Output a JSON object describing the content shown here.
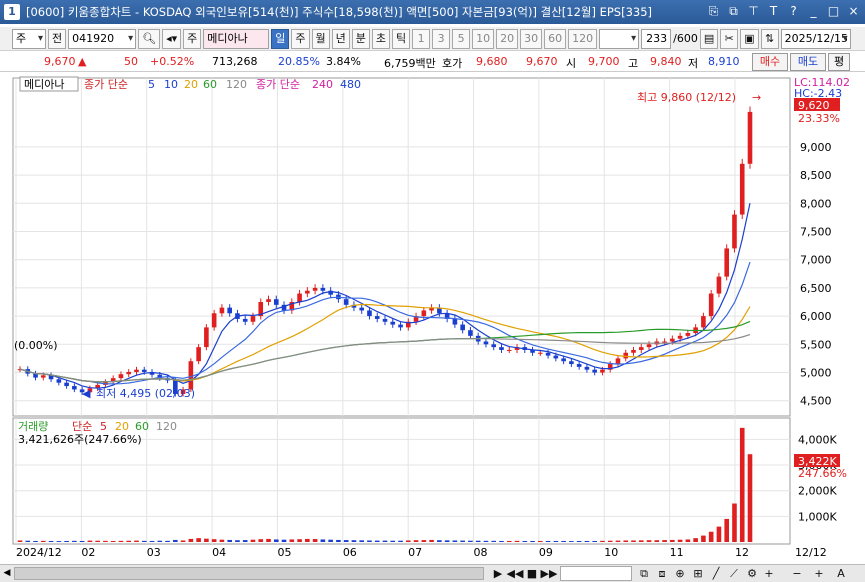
{
  "titlebar": {
    "number": "1",
    "title": "[0600] 키움종합차트 - KOSDAQ 외국인보유[514(천)] 주식수[18,598(천)] 액면[500] 자본금[93(억)] 결산[12월] EPS[335]"
  },
  "toolbar": {
    "type_label": "주",
    "prev_label": "전",
    "stock_code": "041920",
    "stock_type_badge": "주",
    "stock_name": "메디아나",
    "periods": [
      "일",
      "주",
      "월",
      "년",
      "분",
      "초",
      "틱"
    ],
    "intervals": [
      "1",
      "3",
      "5",
      "10",
      "20",
      "30",
      "60",
      "120"
    ],
    "count": "233",
    "count_total": "/600",
    "date": "2025/12/15"
  },
  "info": {
    "price": "9,670",
    "change_symbol": "▲",
    "change": "50",
    "change_pct": "+0.52%",
    "volume": "713,268",
    "rate1": "20.85%",
    "rate2": "3.84%",
    "amount": "6,759백만",
    "quote_label": "호가",
    "ask": "9,680",
    "bid": "9,670",
    "open_label": "시",
    "open": "9,700",
    "high_label": "고",
    "high": "9,840",
    "low_label": "저",
    "low": "8,910",
    "buy_label": "매수",
    "sell_label": "매도",
    "avg_label": "평"
  },
  "chart_data": [
    {
      "type": "candlestick",
      "title": "메디아나",
      "legend": [
        {
          "name": "종가 단순",
          "color": "#cc2222"
        },
        {
          "name": "5",
          "color": "#1a3fd0"
        },
        {
          "name": "10",
          "color": "#1a3fd0"
        },
        {
          "name": "20",
          "color": "#e0a000"
        },
        {
          "name": "60",
          "color": "#2a9a2a"
        },
        {
          "name": "120",
          "color": "#8a8a8a"
        },
        {
          "name": "종가 단순",
          "color": "#d020a0"
        },
        {
          "name": "240",
          "color": "#d020a0"
        },
        {
          "name": "480",
          "color": "#1a3fd0"
        }
      ],
      "ylim": [
        4300,
        10150
      ],
      "y_ticks": [
        "9,000",
        "8,500",
        "8,000",
        "7,500",
        "7,000",
        "6,500",
        "6,000",
        "5,500",
        "5,000",
        "4,500"
      ],
      "x_ticks": [
        "2024/12",
        "02",
        "03",
        "04",
        "05",
        "06",
        "07",
        "08",
        "09",
        "10",
        "11",
        "12",
        "12/12"
      ],
      "right_labels": {
        "lc": "LC:114.02",
        "hc": "HC:-2.43",
        "current": "9,620",
        "current_pct": "23.33%"
      },
      "left_label": "(0.00%)",
      "annotations": {
        "high": "최고 9,860 (12/12)",
        "low": "최저 4,495 (02/03)"
      },
      "close": [
        5060,
        4980,
        4910,
        4950,
        4880,
        4820,
        4760,
        4700,
        4650,
        4720,
        4780,
        4830,
        4900,
        4970,
        5010,
        5050,
        5010,
        4960,
        4900,
        4860,
        4620,
        4700,
        5200,
        5450,
        5800,
        6050,
        6150,
        6050,
        5950,
        5900,
        6000,
        6250,
        6300,
        6200,
        6100,
        6250,
        6400,
        6450,
        6500,
        6450,
        6380,
        6300,
        6200,
        6150,
        6100,
        6000,
        5950,
        5900,
        5850,
        5800,
        5900,
        6000,
        6100,
        6150,
        6050,
        5950,
        5850,
        5750,
        5650,
        5550,
        5500,
        5450,
        5400,
        5400,
        5450,
        5400,
        5350,
        5350,
        5300,
        5250,
        5200,
        5150,
        5100,
        5050,
        5000,
        5050,
        5150,
        5250,
        5350,
        5400,
        5450,
        5500,
        5550,
        5550,
        5600,
        5650,
        5700,
        5800,
        6000,
        6400,
        6700,
        7200,
        7800,
        8700,
        9620
      ],
      "volume_panel": {
        "legend": [
          {
            "name": "거래량",
            "color": "#2a9a2a"
          },
          {
            "name": "단순",
            "color": "#cc2222"
          },
          {
            "name": "5",
            "color": "#cc2222"
          },
          {
            "name": "20",
            "color": "#e0a000"
          },
          {
            "name": "60",
            "color": "#2a9a2a"
          },
          {
            "name": "120",
            "color": "#8a8a8a"
          }
        ],
        "current_text": "3,421,626주(247.66%)",
        "ylim": [
          0,
          4600
        ],
        "y_ticks": [
          "4,000K",
          "3,000K",
          "2,000K",
          "1,000K"
        ],
        "right_labels": {
          "current": "3,422K",
          "current_pct": "247.66%"
        },
        "values": [
          60,
          50,
          40,
          45,
          40,
          35,
          40,
          45,
          40,
          55,
          50,
          45,
          40,
          45,
          50,
          55,
          45,
          40,
          50,
          45,
          80,
          60,
          120,
          150,
          130,
          110,
          90,
          80,
          70,
          75,
          90,
          110,
          120,
          100,
          90,
          100,
          110,
          120,
          115,
          100,
          90,
          80,
          75,
          70,
          65,
          60,
          55,
          55,
          50,
          50,
          60,
          70,
          75,
          80,
          70,
          65,
          60,
          55,
          50,
          50,
          45,
          45,
          40,
          40,
          45,
          40,
          40,
          40,
          40,
          40,
          40,
          35,
          40,
          40,
          40,
          45,
          50,
          55,
          60,
          60,
          65,
          70,
          70,
          75,
          80,
          90,
          100,
          150,
          250,
          400,
          600,
          900,
          1500,
          4450,
          3422
        ]
      }
    }
  ],
  "scroll": {
    "left_arrow": "◀",
    "right_arrow": "▶",
    "controls": [
      "◀◀",
      "■",
      "▶▶",
      "+",
      "−",
      "+",
      "A"
    ]
  }
}
